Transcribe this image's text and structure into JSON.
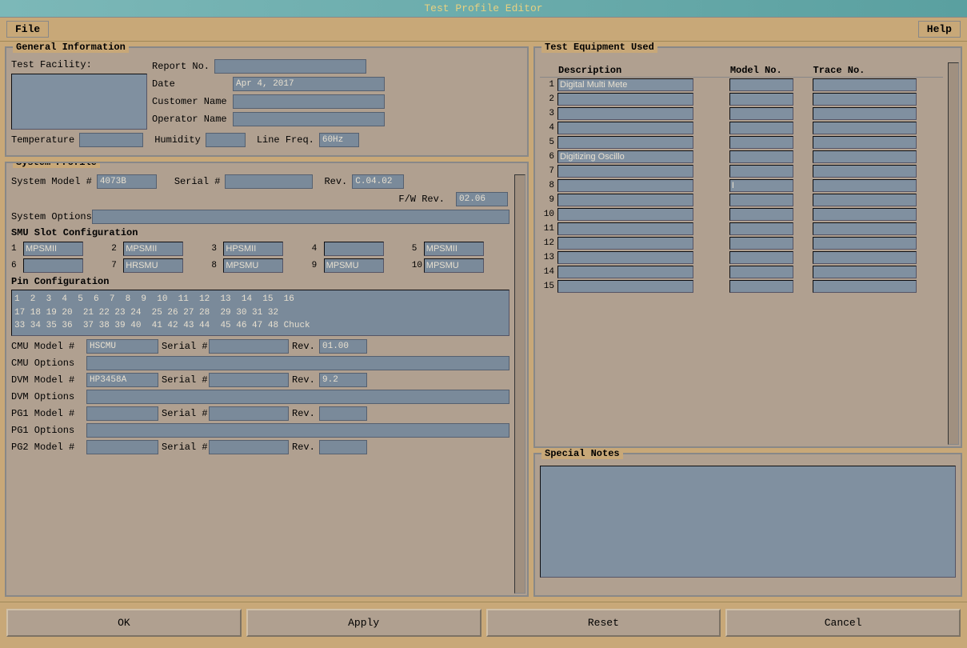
{
  "window": {
    "title": "Test Profile Editor"
  },
  "menubar": {
    "file_label": "File",
    "help_label": "Help"
  },
  "general_info": {
    "title": "General Information",
    "test_facility_label": "Test Facility:",
    "report_no_label": "Report No.",
    "report_no_value": "",
    "date_label": "Date",
    "date_value": "Apr 4, 2017",
    "customer_name_label": "Customer Name",
    "customer_name_value": "",
    "operator_name_label": "Operator Name",
    "operator_name_value": "",
    "temperature_label": "Temperature",
    "temperature_value": "",
    "humidity_label": "Humidity",
    "humidity_value": "",
    "line_freq_label": "Line Freq.",
    "line_freq_value": "60Hz"
  },
  "system_profile": {
    "title": "System Profile",
    "system_model_label": "System Model #",
    "system_model_value": "4073B",
    "serial_label": "Serial #",
    "serial_value": "",
    "rev_label": "Rev.",
    "rev_value": "C.04.02",
    "fw_rev_label": "F/W Rev.",
    "fw_rev_value": "02.06",
    "system_options_label": "System Options",
    "system_options_value": "",
    "smu_slot_title": "SMU Slot Configuration",
    "smu_slots": [
      {
        "num": "1",
        "value": "MPSMII"
      },
      {
        "num": "2",
        "value": "MPSMII"
      },
      {
        "num": "3",
        "value": "HPSMII"
      },
      {
        "num": "4",
        "value": ""
      },
      {
        "num": "5",
        "value": "MPSMII"
      },
      {
        "num": "6",
        "value": ""
      },
      {
        "num": "7",
        "value": "HRSMU"
      },
      {
        "num": "8",
        "value": "MPSMU"
      },
      {
        "num": "9",
        "value": "MPSMU"
      },
      {
        "num": "10",
        "value": "MPSMU"
      }
    ],
    "pin_config_title": "Pin Configuration",
    "pin_config_value": "1  2  3  4  5  6  7  8  9  10  11  12  13  14  15  16\n17 18 19 20  21 22 23 24  25 26 27 28  29 30 31 32\n33 34 35 36  37 38 39 40  41 42 43 44  45 46 47 48 Chuck",
    "cmu_model_label": "CMU Model #",
    "cmu_model_value": "HSCMU",
    "cmu_serial_label": "Serial #",
    "cmu_serial_value": "",
    "cmu_rev_label": "Rev.",
    "cmu_rev_value": "01.00",
    "cmu_options_label": "CMU Options",
    "cmu_options_value": "",
    "dvm_model_label": "DVM Model #",
    "dvm_model_value": "HP3458A",
    "dvm_serial_label": "Serial #",
    "dvm_serial_value": "",
    "dvm_rev_label": "Rev.",
    "dvm_rev_value": "9.2",
    "dvm_options_label": "DVM Options",
    "dvm_options_value": "",
    "pg1_model_label": "PG1 Model #",
    "pg1_model_value": "",
    "pg1_serial_label": "Serial #",
    "pg1_serial_value": "",
    "pg1_rev_label": "Rev.",
    "pg1_rev_value": "",
    "pg1_options_label": "PG1 Options",
    "pg1_options_value": "",
    "pg2_model_label": "PG2 Model #",
    "pg2_model_value": "",
    "pg2_serial_label": "Serial #",
    "pg2_serial_value": "",
    "pg2_rev_label": "Rev.",
    "pg2_rev_value": ""
  },
  "test_equipment": {
    "title": "Test Equipment Used",
    "col_description": "Description",
    "col_model": "Model No.",
    "col_trace": "Trace No.",
    "rows": [
      {
        "num": "1",
        "desc": "Digital Multi Mete",
        "model": "",
        "trace": ""
      },
      {
        "num": "2",
        "desc": "",
        "model": "",
        "trace": ""
      },
      {
        "num": "3",
        "desc": "",
        "model": "",
        "trace": ""
      },
      {
        "num": "4",
        "desc": "",
        "model": "",
        "trace": ""
      },
      {
        "num": "5",
        "desc": "",
        "model": "",
        "trace": ""
      },
      {
        "num": "6",
        "desc": "Digitizing Oscillo",
        "model": "",
        "trace": ""
      },
      {
        "num": "7",
        "desc": "",
        "model": "",
        "trace": ""
      },
      {
        "num": "8",
        "desc": "",
        "model": "I",
        "trace": ""
      },
      {
        "num": "9",
        "desc": "",
        "model": "",
        "trace": ""
      },
      {
        "num": "10",
        "desc": "",
        "model": "",
        "trace": ""
      },
      {
        "num": "11",
        "desc": "",
        "model": "",
        "trace": ""
      },
      {
        "num": "12",
        "desc": "",
        "model": "",
        "trace": ""
      },
      {
        "num": "13",
        "desc": "",
        "model": "",
        "trace": ""
      },
      {
        "num": "14",
        "desc": "",
        "model": "",
        "trace": ""
      },
      {
        "num": "15",
        "desc": "",
        "model": "",
        "trace": ""
      }
    ]
  },
  "special_notes": {
    "title": "Special Notes",
    "value": ""
  },
  "buttons": {
    "ok": "OK",
    "apply": "Apply",
    "reset": "Reset",
    "cancel": "Cancel"
  }
}
